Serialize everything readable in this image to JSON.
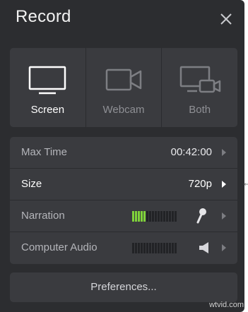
{
  "window": {
    "title": "Record",
    "close_icon": "close-icon"
  },
  "modes": [
    {
      "label": "Screen",
      "icon": "monitor-icon",
      "selected": true
    },
    {
      "label": "Webcam",
      "icon": "camera-icon",
      "selected": false
    },
    {
      "label": "Both",
      "icon": "screen-and-camera-icon",
      "selected": false
    }
  ],
  "settings": {
    "max_time": {
      "label": "Max Time",
      "value": "00:42:00"
    },
    "size": {
      "label": "Size",
      "value": "720p"
    },
    "narration": {
      "label": "Narration",
      "meter_level": 0.3,
      "icon": "microphone-icon"
    },
    "computer_audio": {
      "label": "Computer Audio",
      "meter_level": 0,
      "icon": "speaker-icon"
    }
  },
  "preferences": {
    "label": "Preferences..."
  },
  "colors": {
    "panel": "#2c2d30",
    "card": "#3a3b3f",
    "meter_on": "#7fd23a"
  },
  "watermark": "wtvid.com"
}
